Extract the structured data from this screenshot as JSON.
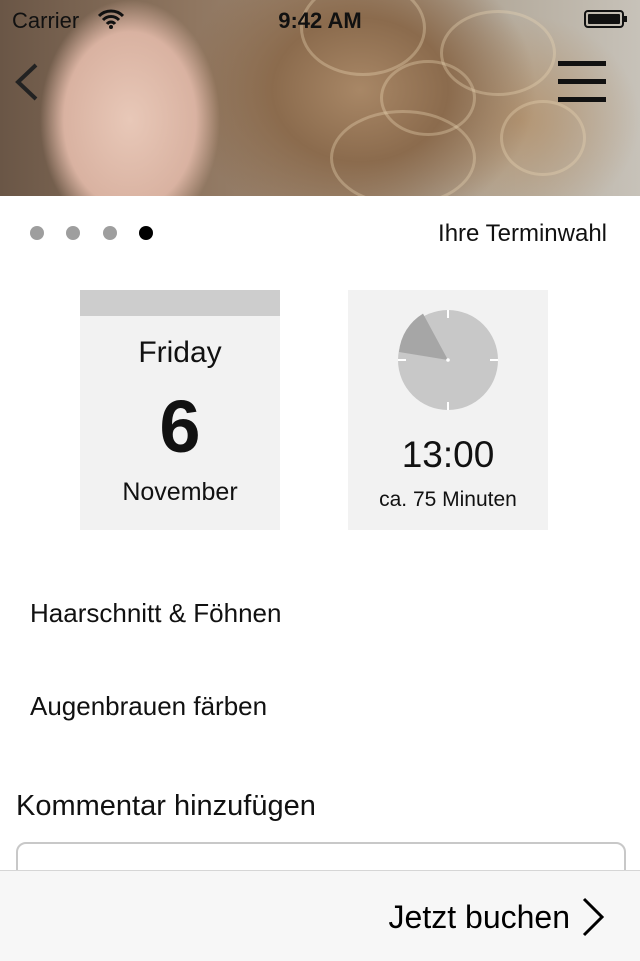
{
  "status_bar": {
    "carrier": "Carrier",
    "time": "9:42 AM"
  },
  "header": {
    "back_icon": "chevron-left-icon",
    "menu_icon": "hamburger-menu-icon"
  },
  "pager": {
    "total": 4,
    "active_index": 3
  },
  "section_title": "Ihre Terminwahl",
  "date_card": {
    "weekday": "Friday",
    "day": "6",
    "month": "November"
  },
  "time_card": {
    "time": "13:00",
    "duration": "ca. 75 Minuten"
  },
  "services": [
    {
      "label": "Haarschnitt & Föhnen"
    },
    {
      "label": "Augenbrauen färben"
    }
  ],
  "comment": {
    "label": "Kommentar hinzufügen",
    "value": ""
  },
  "footer": {
    "book_label": "Jetzt buchen"
  },
  "colors": {
    "card_bg": "#f2f2f2",
    "card_bar": "#cdcdcd",
    "clock_face": "#c8c8c8",
    "clock_segment": "#a6a6a6"
  }
}
